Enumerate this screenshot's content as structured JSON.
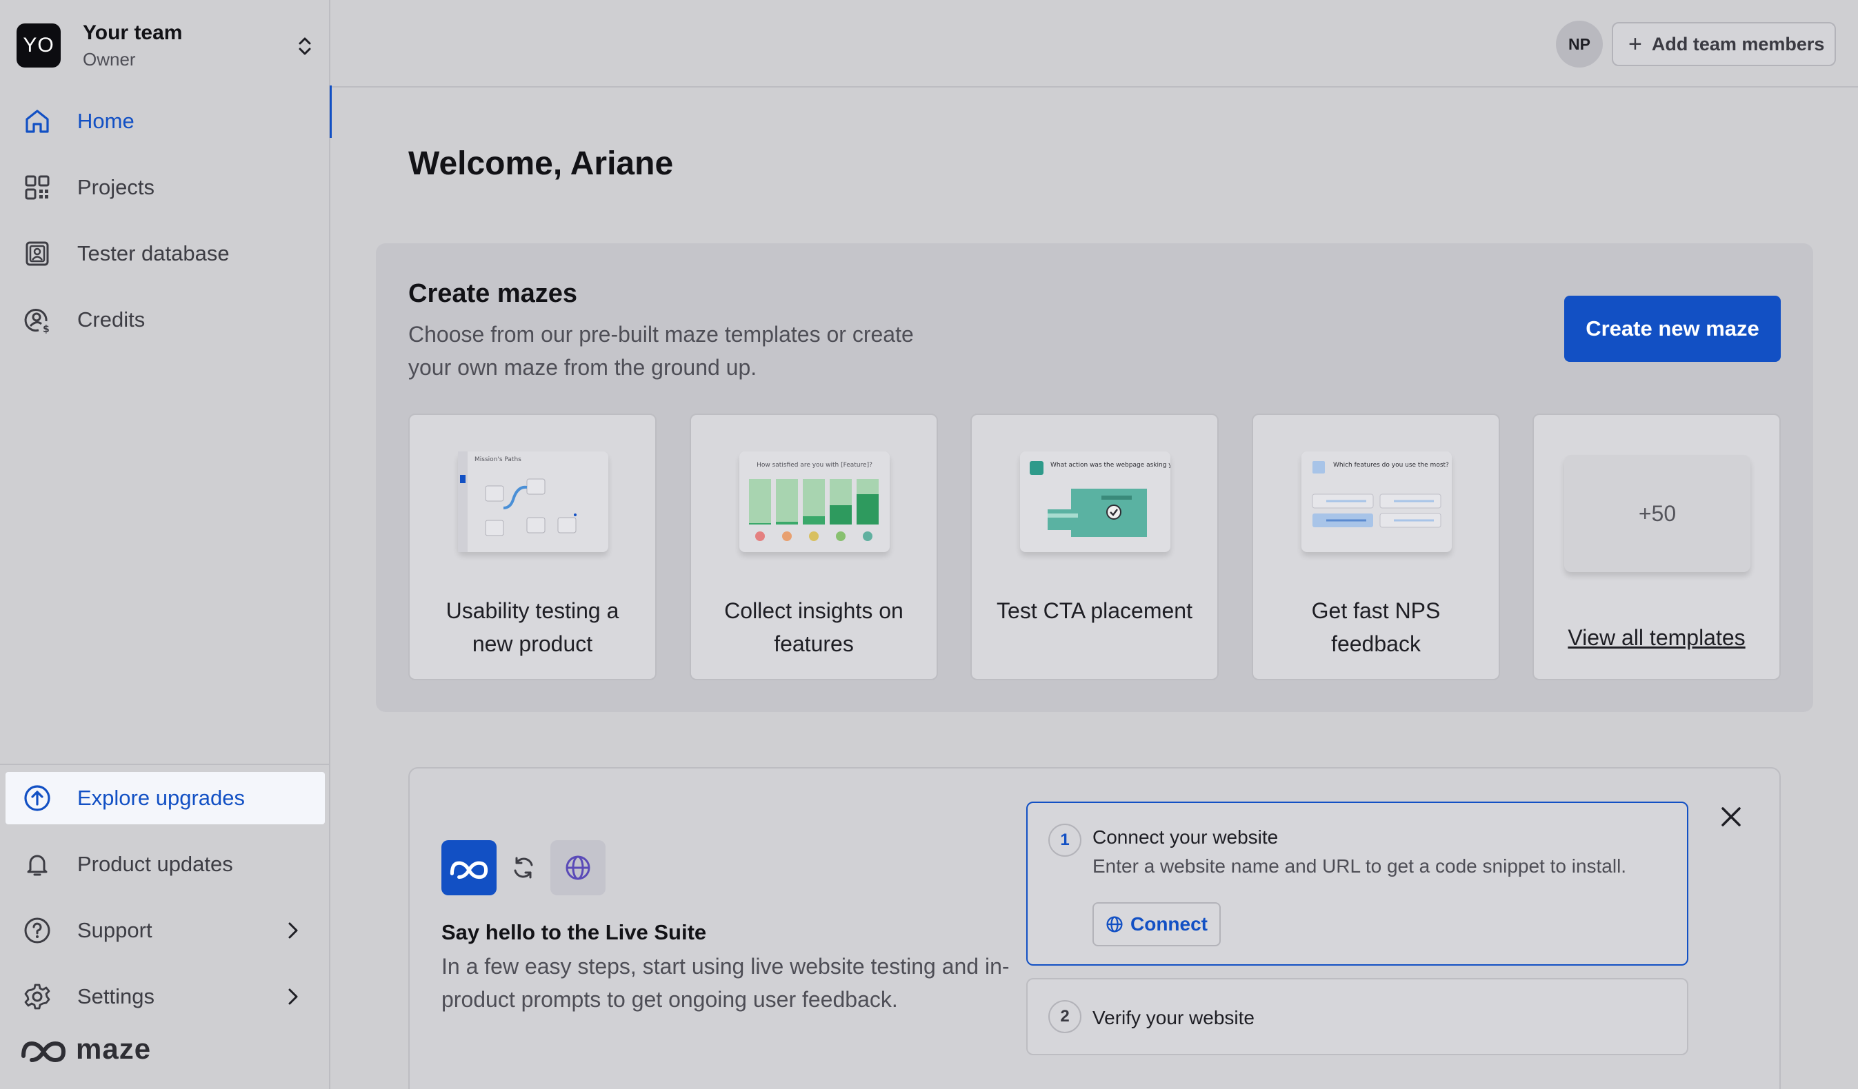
{
  "team": {
    "initials": "YO",
    "name": "Your team",
    "role": "Owner"
  },
  "nav": {
    "items": [
      {
        "label": "Home",
        "icon": "home-icon",
        "active": true
      },
      {
        "label": "Projects",
        "icon": "grid-icon"
      },
      {
        "label": "Tester database",
        "icon": "contacts-icon"
      },
      {
        "label": "Credits",
        "icon": "credits-icon"
      }
    ],
    "bottom": [
      {
        "label": "Explore upgrades",
        "icon": "arrow-up-circle-icon"
      },
      {
        "label": "Product updates",
        "icon": "bell-icon"
      },
      {
        "label": "Support",
        "icon": "question-circle-icon"
      },
      {
        "label": "Settings",
        "icon": "gear-icon"
      }
    ]
  },
  "brand": {
    "name": "maze"
  },
  "topbar": {
    "user_initials": "NP",
    "add_members_label": "Add team members"
  },
  "welcome": "Welcome, Ariane",
  "create": {
    "title": "Create mazes",
    "description": "Choose from our pre-built maze templates or create your own maze from the ground up.",
    "button": "Create new maze",
    "templates": [
      {
        "label": "Usability testing a new product",
        "thumb_text": "Mission's Paths"
      },
      {
        "label": "Collect insights on features",
        "thumb_text": "How satisfied are you with [Feature]?"
      },
      {
        "label": "Test CTA placement",
        "thumb_text": "What action was the webpage asking you to take?"
      },
      {
        "label": "Get fast NPS feedback",
        "thumb_text": "Which features do you use the most?"
      }
    ],
    "more_count": "+50",
    "view_all": "View all templates"
  },
  "live": {
    "title": "Say hello to the Live Suite",
    "description": "In a few easy steps, start using live website testing and in-product prompts to get ongoing user feedback.",
    "step1": {
      "num": "1",
      "title": "Connect your website",
      "desc": "Enter a website name and URL to get a code snippet to install.",
      "button": "Connect"
    },
    "step2": {
      "num": "2",
      "title": "Verify your website"
    }
  },
  "colors": {
    "accent": "#1250c4",
    "overlay_bg": "#cfcfd2"
  }
}
